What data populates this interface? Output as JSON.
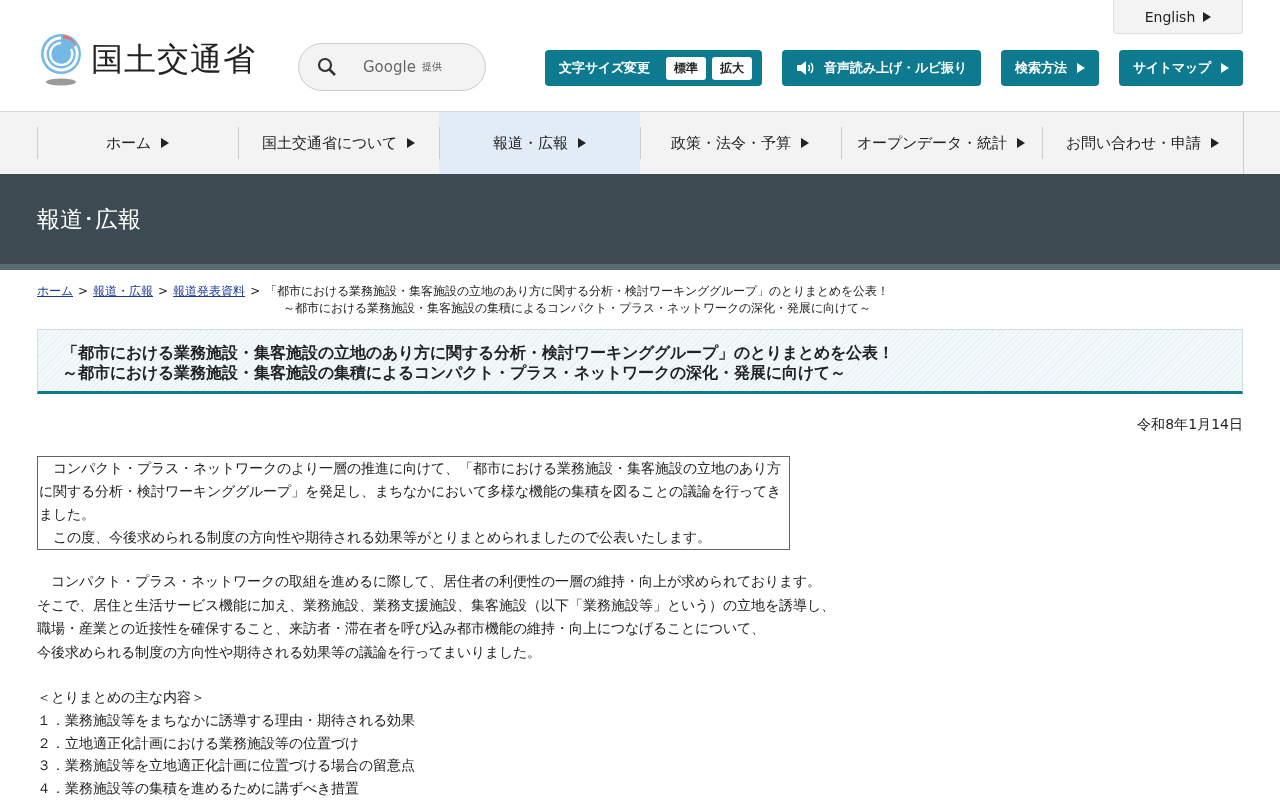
{
  "header": {
    "logo_text": "国土交通省",
    "search": {
      "brand": "Google",
      "suffix": "提供"
    },
    "english_link": "English",
    "font_size": {
      "label": "文字サイズ変更",
      "options": [
        {
          "label": "標準",
          "selected": false
        },
        {
          "label": "拡大",
          "selected": false
        }
      ]
    },
    "tools": [
      {
        "label": "音声読み上げ・ルビ振り",
        "kind": "speaker"
      },
      {
        "label": "検索方法",
        "kind": "arrow"
      },
      {
        "label": "サイトマップ",
        "kind": "arrow"
      }
    ]
  },
  "nav": [
    {
      "label": "ホーム",
      "selected": false
    },
    {
      "label": "国土交通省について",
      "selected": false
    },
    {
      "label": "報道・広報",
      "selected": true
    },
    {
      "label": "政策・法令・予算",
      "selected": false
    },
    {
      "label": "オープンデータ・統計",
      "selected": false
    },
    {
      "label": "お問い合わせ・申請",
      "selected": false
    }
  ],
  "banner_title": "報道･広報",
  "breadcrumb": {
    "links": [
      "ホーム",
      "報道・広報",
      "報道発表資料"
    ],
    "separator": ">",
    "current": [
      "「都市における業務施設・集客施設の立地のあり方に関する分析・検討ワーキンググループ」のとりまとめを公表！",
      "～都市における業務施設・集客施設の集積によるコンパクト・プラス・ネットワークの深化・発展に向けて～"
    ]
  },
  "heading": [
    "「都市における業務施設・集客施設の立地のあり方に関する分析・検討ワーキンググループ」のとりまとめを公表！",
    "～都市における業務施設・集客施設の集積によるコンパクト・プラス・ネットワークの深化・発展に向けて～"
  ],
  "date": "令和8年1月14日",
  "summary": [
    "　コンパクト・プラス・ネットワークのより一層の推進に向けて、「都市における業務施設・集客施設の立地のあり方に関する分析・検討ワーキンググループ」を発足し、まちなかにおいて多様な機能の集積を図ることの議論を行ってきました。",
    "　この度、今後求められる制度の方向性や期待される効果等がとりまとめられましたので公表いたします。"
  ],
  "body_lines": [
    "　コンパクト・プラス・ネットワークの取組を進めるに際して、居住者の利便性の一層の維持・向上が求められております。",
    "そこで、居住と生活サービス機能に加え、業務施設、業務支援施設、集客施設（以下「業務施設等」という）の立地を誘導し、",
    "職場・産業との近接性を確保すること、来訪者・滞在者を呼び込み都市機能の維持・向上につなげることについて、",
    "今後求められる制度の方向性や期待される効果等の議論を行ってまいりました。"
  ],
  "contents": {
    "title": "＜とりまとめの主な内容＞",
    "items": [
      "１．業務施設等をまちなかに誘導する理由・期待される効果",
      "２．立地適正化計画における業務施設等の位置づけ",
      "３．業務施設等を立地適正化計画に位置づける場合の留意点",
      "４．業務施設等の集積を進めるために講ずべき措置"
    ]
  }
}
